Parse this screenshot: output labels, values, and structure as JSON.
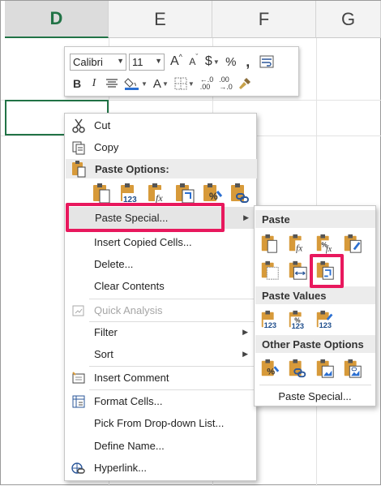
{
  "sheet": {
    "columns": [
      "D",
      "E",
      "F",
      "G"
    ],
    "selected_column": "D"
  },
  "mini_toolbar": {
    "font_name": "Calibri",
    "font_size": "11",
    "grow_font": "A",
    "shrink_font": "A",
    "currency": "$",
    "percent": "%",
    "comma": ",",
    "bold": "B",
    "italic": "I",
    "font_color": "A"
  },
  "context_menu": {
    "items": [
      {
        "label": "Cut",
        "icon": "scissors-icon"
      },
      {
        "label": "Copy",
        "icon": "copy-icon"
      },
      {
        "label": "Paste Options:",
        "icon": "paste-icon",
        "section": true
      },
      {
        "label": "Paste Special...",
        "icon": "",
        "submenu": true
      },
      {
        "label": "Insert Copied Cells...",
        "icon": ""
      },
      {
        "label": "Delete...",
        "icon": ""
      },
      {
        "label": "Clear Contents",
        "icon": ""
      },
      {
        "label": "Quick Analysis",
        "icon": "quick-analysis-icon",
        "disabled": true
      },
      {
        "label": "Filter",
        "icon": "",
        "submenu": true
      },
      {
        "label": "Sort",
        "icon": "",
        "submenu": true
      },
      {
        "label": "Insert Comment",
        "icon": "comment-icon"
      },
      {
        "label": "Format Cells...",
        "icon": "format-cells-icon"
      },
      {
        "label": "Pick From Drop-down List...",
        "icon": ""
      },
      {
        "label": "Define Name...",
        "icon": ""
      },
      {
        "label": "Hyperlink...",
        "icon": "hyperlink-icon"
      }
    ]
  },
  "paste_submenu": {
    "paste_header": "Paste",
    "paste_values_header": "Paste Values",
    "other_header": "Other Paste Options",
    "footer_link": "Paste Special..."
  },
  "colors": {
    "excel_green": "#217346",
    "highlight_pink": "#e8185d",
    "clipboard_orange": "#d79a3a"
  }
}
